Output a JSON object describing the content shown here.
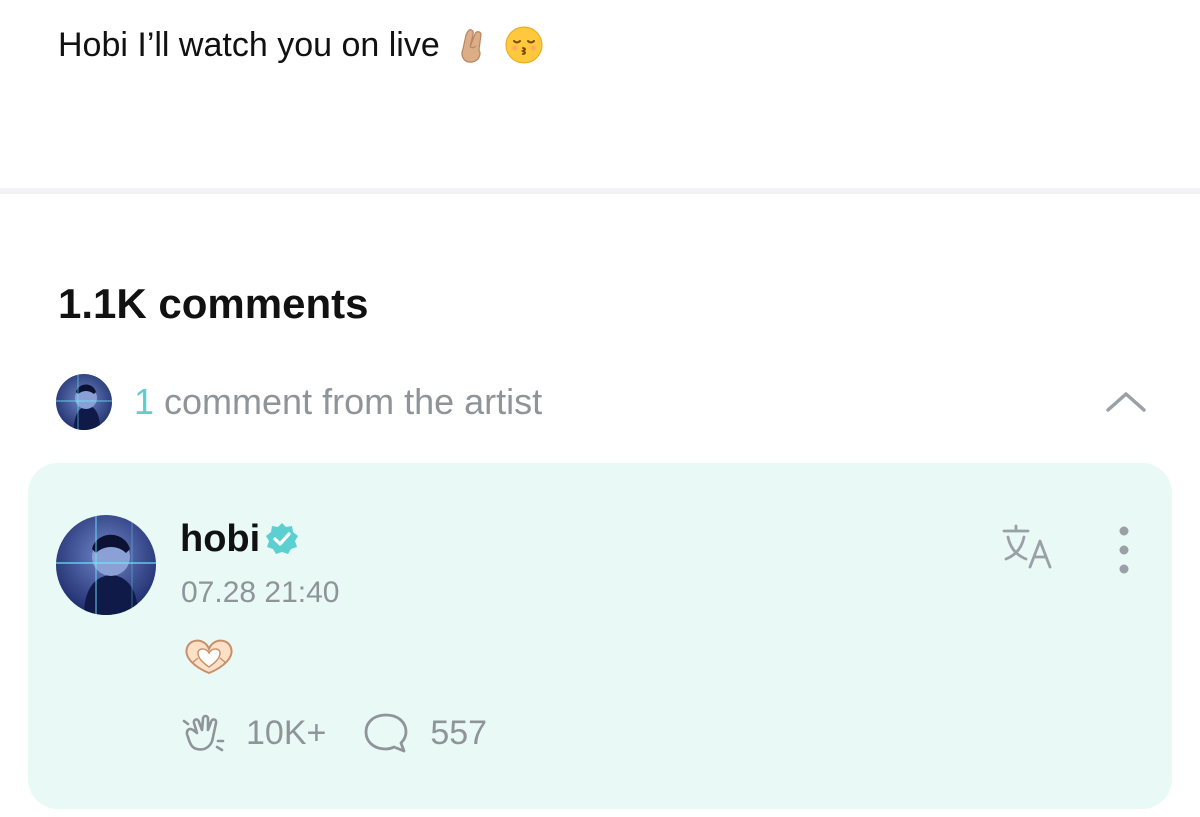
{
  "post": {
    "text": "Hobi I’ll watch you on live",
    "emojis": [
      "crossed-fingers-icon",
      "kissing-face-icon"
    ]
  },
  "comments": {
    "title": "1.1K comments",
    "artist_count": "1",
    "artist_label": " comment from the artist"
  },
  "comment": {
    "username": "hobi",
    "verified": true,
    "timestamp": "07.28 21:40",
    "content_emoji": "heart-hands-icon",
    "likes": "10K+",
    "replies": "557"
  },
  "colors": {
    "accent": "#5ccfd1",
    "card_background": "#e8f9f6",
    "muted_text": "#8f9499"
  }
}
